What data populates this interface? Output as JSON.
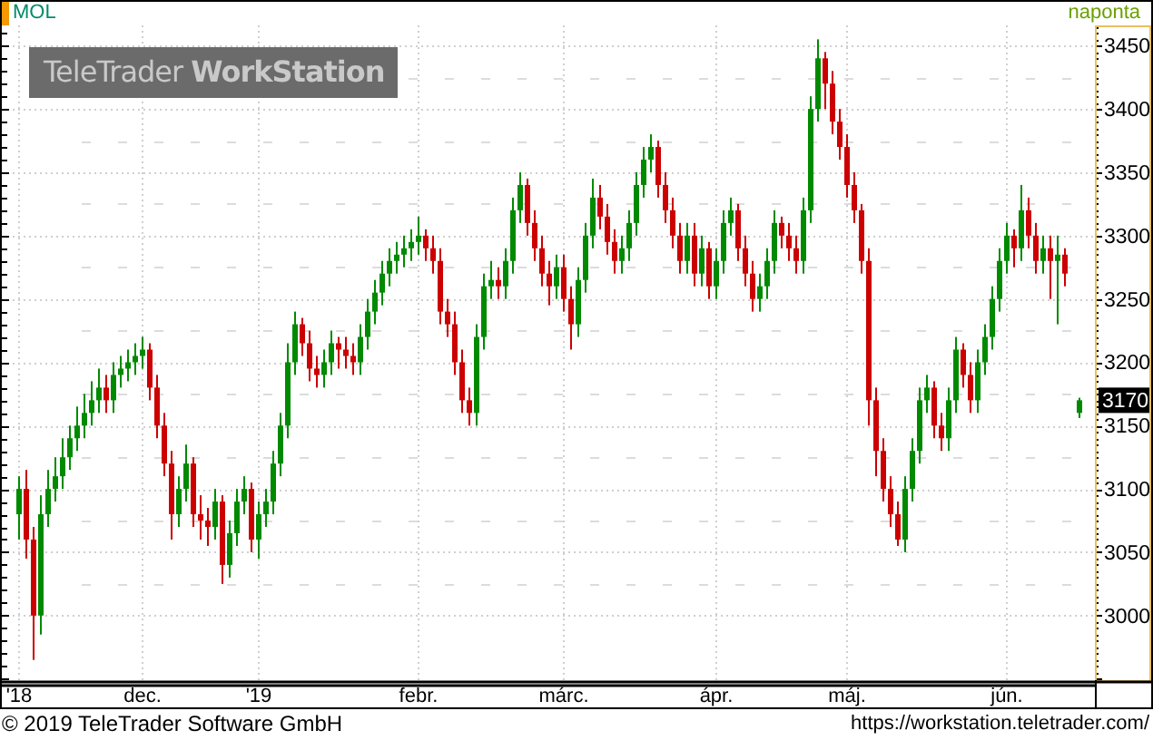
{
  "header": {
    "symbol": "MOL",
    "interval": "naponta"
  },
  "logo": {
    "text_regular": "TeleTrader",
    "text_bold": "WorkStation"
  },
  "chart": {
    "chart_data": {
      "type": "candlestick",
      "grid": true,
      "ylim": [
        2949,
        3466
      ],
      "yticks": [
        3000,
        3050,
        3100,
        3150,
        3200,
        3250,
        3300,
        3350,
        3400,
        3450
      ],
      "categories": [
        "'18",
        null,
        null,
        null,
        null,
        null,
        null,
        null,
        null,
        null,
        null,
        null,
        null,
        null,
        null,
        null,
        null,
        "dec.",
        null,
        null,
        null,
        null,
        null,
        null,
        null,
        null,
        null,
        null,
        null,
        null,
        null,
        null,
        null,
        "'19",
        null,
        null,
        null,
        null,
        null,
        null,
        null,
        null,
        null,
        null,
        null,
        null,
        null,
        null,
        null,
        null,
        null,
        null,
        null,
        null,
        null,
        "febr.",
        null,
        null,
        null,
        null,
        null,
        null,
        null,
        null,
        null,
        null,
        null,
        null,
        null,
        null,
        null,
        null,
        null,
        null,
        null,
        "márc.",
        null,
        null,
        null,
        null,
        null,
        null,
        null,
        null,
        null,
        null,
        null,
        null,
        null,
        null,
        null,
        null,
        null,
        null,
        null,
        null,
        "ápr.",
        null,
        null,
        null,
        null,
        null,
        null,
        null,
        null,
        null,
        null,
        null,
        null,
        null,
        null,
        null,
        null,
        null,
        "máj.",
        null,
        null,
        null,
        null,
        null,
        null,
        null,
        null,
        null,
        null,
        null,
        null,
        null,
        null,
        null,
        null,
        null,
        null,
        null,
        null,
        null,
        "jún.",
        null,
        null,
        null,
        null,
        null,
        null,
        null,
        null,
        null,
        null
      ],
      "ohlc": [
        [
          3080,
          3110,
          3060,
          3100
        ],
        [
          3100,
          3115,
          3045,
          3060
        ],
        [
          3060,
          3070,
          2965,
          3000
        ],
        [
          3000,
          3095,
          2985,
          3080
        ],
        [
          3080,
          3115,
          3070,
          3100
        ],
        [
          3100,
          3125,
          3090,
          3110
        ],
        [
          3110,
          3140,
          3100,
          3125
        ],
        [
          3125,
          3150,
          3115,
          3140
        ],
        [
          3140,
          3165,
          3130,
          3150
        ],
        [
          3150,
          3175,
          3140,
          3160
        ],
        [
          3160,
          3185,
          3150,
          3170
        ],
        [
          3170,
          3195,
          3160,
          3180
        ],
        [
          3180,
          3190,
          3160,
          3170
        ],
        [
          3170,
          3200,
          3160,
          3190
        ],
        [
          3190,
          3205,
          3180,
          3195
        ],
        [
          3195,
          3210,
          3185,
          3200
        ],
        [
          3200,
          3215,
          3190,
          3205
        ],
        [
          3205,
          3220,
          3195,
          3210
        ],
        [
          3210,
          3215,
          3170,
          3180
        ],
        [
          3180,
          3190,
          3140,
          3150
        ],
        [
          3150,
          3160,
          3110,
          3120
        ],
        [
          3120,
          3130,
          3060,
          3080
        ],
        [
          3080,
          3110,
          3070,
          3100
        ],
        [
          3100,
          3135,
          3090,
          3120
        ],
        [
          3120,
          3125,
          3070,
          3080
        ],
        [
          3080,
          3095,
          3060,
          3075
        ],
        [
          3075,
          3085,
          3055,
          3070
        ],
        [
          3070,
          3100,
          3060,
          3090
        ],
        [
          3090,
          3095,
          3025,
          3040
        ],
        [
          3040,
          3075,
          3030,
          3065
        ],
        [
          3065,
          3100,
          3055,
          3090
        ],
        [
          3090,
          3110,
          3080,
          3100
        ],
        [
          3100,
          3105,
          3050,
          3060
        ],
        [
          3060,
          3090,
          3045,
          3080
        ],
        [
          3080,
          3100,
          3070,
          3090
        ],
        [
          3090,
          3130,
          3080,
          3120
        ],
        [
          3120,
          3160,
          3110,
          3150
        ],
        [
          3150,
          3215,
          3140,
          3200
        ],
        [
          3200,
          3240,
          3190,
          3230
        ],
        [
          3230,
          3235,
          3205,
          3215
        ],
        [
          3215,
          3225,
          3185,
          3195
        ],
        [
          3195,
          3205,
          3180,
          3190
        ],
        [
          3190,
          3210,
          3180,
          3200
        ],
        [
          3200,
          3225,
          3190,
          3215
        ],
        [
          3215,
          3220,
          3195,
          3210
        ],
        [
          3210,
          3220,
          3195,
          3205
        ],
        [
          3205,
          3215,
          3190,
          3200
        ],
        [
          3200,
          3230,
          3190,
          3220
        ],
        [
          3220,
          3250,
          3210,
          3240
        ],
        [
          3240,
          3265,
          3230,
          3255
        ],
        [
          3255,
          3280,
          3245,
          3270
        ],
        [
          3270,
          3290,
          3260,
          3280
        ],
        [
          3280,
          3295,
          3270,
          3285
        ],
        [
          3285,
          3300,
          3275,
          3290
        ],
        [
          3290,
          3305,
          3280,
          3295
        ],
        [
          3295,
          3315,
          3285,
          3300
        ],
        [
          3300,
          3305,
          3280,
          3290
        ],
        [
          3290,
          3300,
          3270,
          3280
        ],
        [
          3280,
          3290,
          3230,
          3240
        ],
        [
          3240,
          3250,
          3220,
          3230
        ],
        [
          3230,
          3240,
          3190,
          3200
        ],
        [
          3200,
          3210,
          3160,
          3170
        ],
        [
          3170,
          3180,
          3150,
          3160
        ],
        [
          3160,
          3230,
          3150,
          3220
        ],
        [
          3220,
          3270,
          3210,
          3260
        ],
        [
          3260,
          3280,
          3250,
          3265
        ],
        [
          3265,
          3275,
          3250,
          3260
        ],
        [
          3260,
          3290,
          3250,
          3280
        ],
        [
          3280,
          3330,
          3270,
          3320
        ],
        [
          3320,
          3350,
          3310,
          3340
        ],
        [
          3340,
          3345,
          3300,
          3310
        ],
        [
          3310,
          3320,
          3280,
          3290
        ],
        [
          3290,
          3300,
          3260,
          3270
        ],
        [
          3270,
          3280,
          3245,
          3260
        ],
        [
          3260,
          3285,
          3250,
          3275
        ],
        [
          3275,
          3285,
          3240,
          3250
        ],
        [
          3250,
          3260,
          3210,
          3230
        ],
        [
          3230,
          3275,
          3220,
          3265
        ],
        [
          3265,
          3310,
          3255,
          3300
        ],
        [
          3300,
          3345,
          3290,
          3330
        ],
        [
          3330,
          3340,
          3305,
          3315
        ],
        [
          3315,
          3325,
          3285,
          3295
        ],
        [
          3295,
          3305,
          3270,
          3280
        ],
        [
          3280,
          3300,
          3270,
          3290
        ],
        [
          3290,
          3320,
          3280,
          3310
        ],
        [
          3310,
          3350,
          3300,
          3340
        ],
        [
          3340,
          3370,
          3330,
          3360
        ],
        [
          3360,
          3380,
          3350,
          3370
        ],
        [
          3370,
          3375,
          3330,
          3340
        ],
        [
          3340,
          3350,
          3310,
          3320
        ],
        [
          3320,
          3330,
          3290,
          3300
        ],
        [
          3300,
          3310,
          3270,
          3280
        ],
        [
          3280,
          3310,
          3270,
          3300
        ],
        [
          3300,
          3310,
          3260,
          3270
        ],
        [
          3270,
          3300,
          3260,
          3290
        ],
        [
          3290,
          3295,
          3250,
          3260
        ],
        [
          3260,
          3290,
          3250,
          3280
        ],
        [
          3280,
          3320,
          3270,
          3310
        ],
        [
          3310,
          3330,
          3300,
          3320
        ],
        [
          3320,
          3325,
          3280,
          3290
        ],
        [
          3290,
          3300,
          3260,
          3270
        ],
        [
          3270,
          3280,
          3240,
          3250
        ],
        [
          3250,
          3270,
          3240,
          3260
        ],
        [
          3260,
          3290,
          3250,
          3280
        ],
        [
          3280,
          3320,
          3270,
          3310
        ],
        [
          3310,
          3315,
          3290,
          3300
        ],
        [
          3300,
          3310,
          3280,
          3290
        ],
        [
          3290,
          3300,
          3270,
          3280
        ],
        [
          3280,
          3330,
          3270,
          3320
        ],
        [
          3320,
          3410,
          3310,
          3400
        ],
        [
          3400,
          3455,
          3390,
          3440
        ],
        [
          3440,
          3445,
          3400,
          3420
        ],
        [
          3420,
          3430,
          3380,
          3390
        ],
        [
          3390,
          3400,
          3360,
          3370
        ],
        [
          3370,
          3380,
          3330,
          3340
        ],
        [
          3340,
          3350,
          3310,
          3320
        ],
        [
          3320,
          3325,
          3270,
          3280
        ],
        [
          3280,
          3290,
          3150,
          3170
        ],
        [
          3170,
          3180,
          3110,
          3130
        ],
        [
          3130,
          3140,
          3090,
          3100
        ],
        [
          3100,
          3110,
          3070,
          3080
        ],
        [
          3080,
          3090,
          3055,
          3060
        ],
        [
          3060,
          3110,
          3050,
          3100
        ],
        [
          3100,
          3140,
          3090,
          3130
        ],
        [
          3130,
          3180,
          3120,
          3170
        ],
        [
          3170,
          3190,
          3160,
          3180
        ],
        [
          3180,
          3185,
          3140,
          3150
        ],
        [
          3150,
          3160,
          3130,
          3140
        ],
        [
          3140,
          3180,
          3130,
          3170
        ],
        [
          3170,
          3220,
          3160,
          3210
        ],
        [
          3210,
          3215,
          3180,
          3190
        ],
        [
          3190,
          3200,
          3160,
          3170
        ],
        [
          3170,
          3210,
          3160,
          3200
        ],
        [
          3200,
          3230,
          3190,
          3220
        ],
        [
          3220,
          3260,
          3210,
          3250
        ],
        [
          3250,
          3290,
          3240,
          3280
        ],
        [
          3280,
          3310,
          3270,
          3300
        ],
        [
          3300,
          3305,
          3275,
          3290
        ],
        [
          3290,
          3340,
          3280,
          3320
        ],
        [
          3320,
          3330,
          3290,
          3300
        ],
        [
          3300,
          3310,
          3270,
          3280
        ],
        [
          3280,
          3300,
          3270,
          3290
        ],
        [
          3290,
          3300,
          3250,
          3280
        ],
        [
          3280,
          3300,
          3230,
          3285
        ],
        [
          3285,
          3290,
          3260,
          3270
        ],
        null,
        [
          3160,
          3172,
          3156,
          3170
        ]
      ]
    },
    "last_price": "3170"
  },
  "footer": {
    "copyright": "© 2019 TeleTrader Software GmbH",
    "url": "https://workstation.teletrader.com/"
  }
}
